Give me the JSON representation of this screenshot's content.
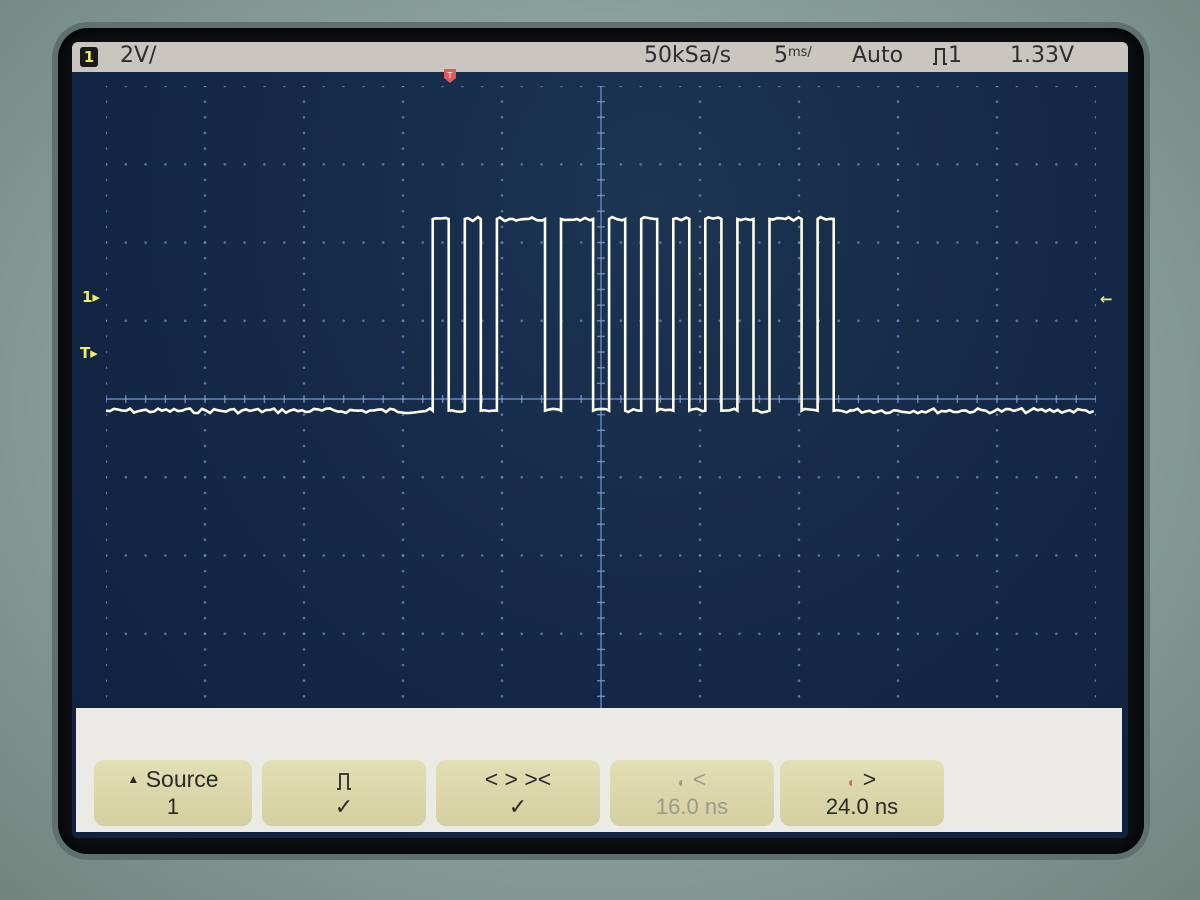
{
  "status_bar": {
    "channel": "1",
    "scale": "2V/",
    "sample_rate": "50kSa/s",
    "timebase": "5",
    "timebase_unit": "ms/",
    "mode": "Auto",
    "trigger_source": "1",
    "trigger_level": "1.33V"
  },
  "softkeys": {
    "source": {
      "label": "Source",
      "value": "1"
    },
    "polarity": {
      "icon": "positive-pulse-icon",
      "check": "✓"
    },
    "qualifier": {
      "label": "< > ><",
      "check": "✓"
    },
    "lower_limit": {
      "label": "<",
      "value": "16.0 ns"
    },
    "upper_limit": {
      "label": ">",
      "value": "24.0 ns"
    }
  },
  "colors": {
    "trace": "#fffde6",
    "grid": "#6f8fc4",
    "status_bg": "#c9c6bf",
    "softkey_bg": "#dcd8a8",
    "marker": "#f3e870"
  },
  "waveform": {
    "bits_from_start": [
      1,
      0,
      1,
      0,
      1,
      1,
      1,
      0,
      1,
      1,
      0,
      1,
      0,
      1,
      0,
      1,
      0,
      1,
      0,
      1,
      0,
      1,
      1,
      0,
      1,
      0
    ],
    "low_level_div": -0.15,
    "high_level_div": 2.3
  }
}
